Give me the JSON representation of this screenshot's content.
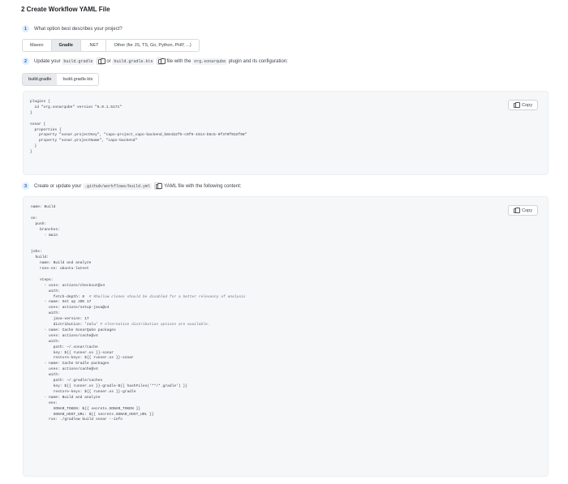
{
  "title": "2 Create Workflow YAML File",
  "step1": {
    "num": "1",
    "text": "What option best describes your project?"
  },
  "build_options": [
    "Maven",
    "Gradle",
    ".NET",
    "Other (for JS, TS, Go, Python, PHP, ...)"
  ],
  "build_selected": "Gradle",
  "step2": {
    "num": "2",
    "t1": "Update your",
    "c1": "build.gradle",
    "t2": "or",
    "c2": "build.gradle.kts",
    "t3": "file with the",
    "c3": "org.sonarqube",
    "t4": "plugin and its configuration:"
  },
  "gradle_tabs": [
    "build.gradle",
    "build.gradle.kts"
  ],
  "gradle_selected": "build.gradle",
  "copy_label": "Copy",
  "gradle_code": [
    "plugins {",
    "  id \"org.sonarqube\" version \"6.0.1.5171\"",
    "}",
    "",
    "sonar {",
    "  properties {",
    "    property \"sonar.projectKey\", \"capo-project_capo-backend_b8e1b2f5-c9f9-4314-b5c5-9f379f032f98\"",
    "    property \"sonar.projectName\", \"capo-backend\"",
    "  }",
    "}"
  ],
  "step3": {
    "num": "3",
    "t1": "Create or update your",
    "c1": ".github/workflows/build.yml",
    "t2": "YAML file with the following content:"
  },
  "yaml_code": [
    "name: Build",
    "",
    "on:",
    "  push:",
    "    branches:",
    "      - main",
    "",
    "",
    "jobs:",
    "  build:",
    "    name: Build and analyze",
    "    runs-on: ubuntu-latest",
    "",
    "    steps:",
    "      - uses: actions/checkout@v4",
    "        with:",
    "          fetch-depth: 0  # Shallow clones should be disabled for a better relevancy of analysis",
    "      - name: Set up JDK 17",
    "        uses: actions/setup-java@v4",
    "        with:",
    "          java-version: 17",
    "          distribution: 'zulu' # Alternative distribution options are available.",
    "      - name: Cache SonarQube packages",
    "        uses: actions/cache@v4",
    "        with:",
    "          path: ~/.sonar/cache",
    "          key: ${{ runner.os }}-sonar",
    "          restore-keys: ${{ runner.os }}-sonar",
    "      - name: Cache Gradle packages",
    "        uses: actions/cache@v4",
    "        with:",
    "          path: ~/.gradle/caches",
    "          key: ${{ runner.os }}-gradle-${{ hashFiles('**/*.gradle') }}",
    "          restore-keys: ${{ runner.os }}-gradle",
    "      - name: Build and analyze",
    "        env:",
    "          SONAR_TOKEN: ${{ secrets.SONAR_TOKEN }}",
    "          SONAR_HOST_URL: ${{ secrets.SONAR_HOST_URL }}",
    "        run: ./gradlew build sonar --info"
  ],
  "colors": {
    "accent": "#2a62b8",
    "step_bg": "#ddeeff",
    "code_bg": "#f6f7f9"
  }
}
